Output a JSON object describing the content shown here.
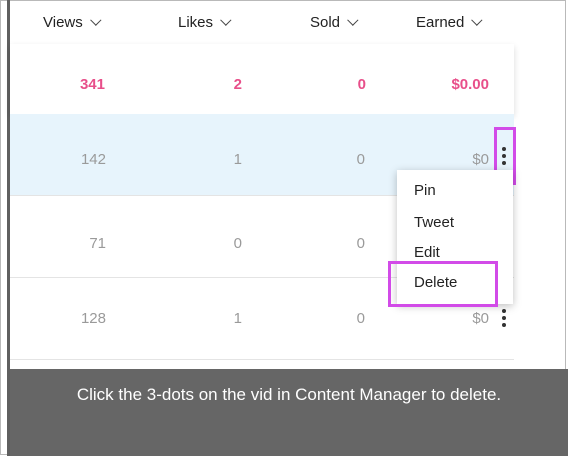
{
  "columns": [
    {
      "label": "Views"
    },
    {
      "label": "Likes"
    },
    {
      "label": "Sold"
    },
    {
      "label": "Earned"
    }
  ],
  "summary": {
    "views": "341",
    "likes": "2",
    "sold": "0",
    "earned": "$0.00"
  },
  "rows": [
    {
      "views": "142",
      "likes": "1",
      "sold": "0",
      "earned": "$0"
    },
    {
      "views": "71",
      "likes": "0",
      "sold": "0",
      "earned": ""
    },
    {
      "views": "128",
      "likes": "1",
      "sold": "0",
      "earned": "$0"
    }
  ],
  "menu": {
    "items": [
      {
        "label": "Pin"
      },
      {
        "label": "Tweet"
      },
      {
        "label": "Edit"
      },
      {
        "label": "Delete"
      }
    ]
  },
  "caption": "Click the 3-dots on the vid in Content Manager to delete.",
  "colors": {
    "accent_pink": "#e84f8a",
    "highlight_magenta": "#d24be8",
    "row_highlight": "#e7f4fc",
    "caption_bg": "#666666"
  }
}
